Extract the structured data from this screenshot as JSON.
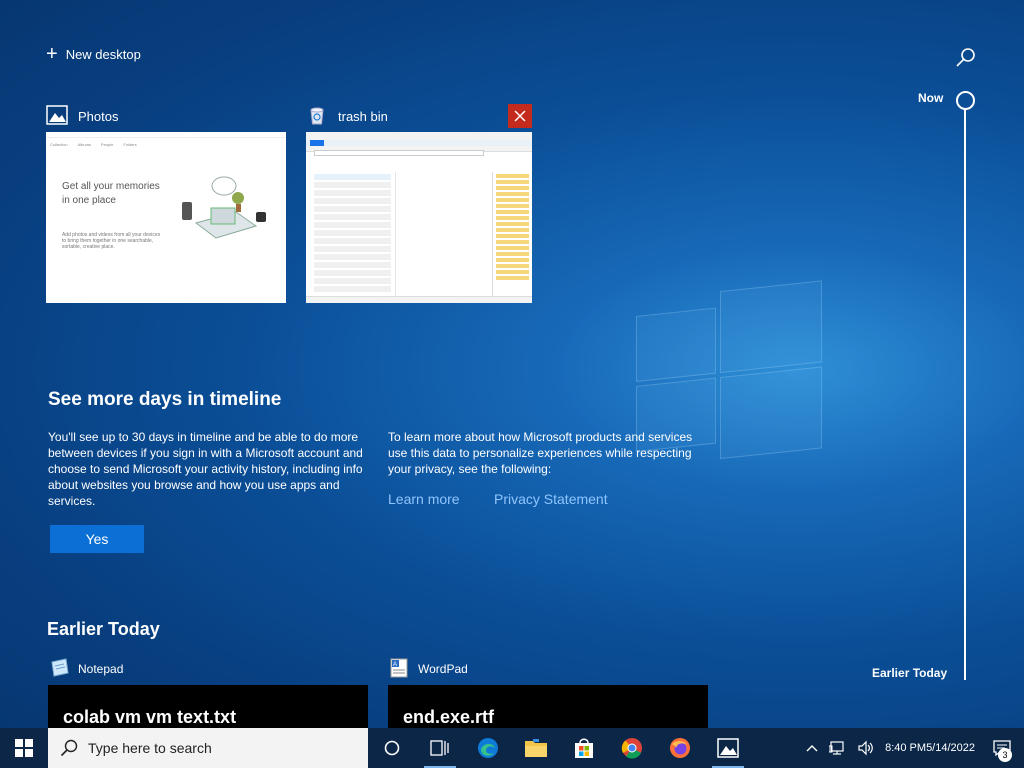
{
  "new_desktop": {
    "label": "New desktop"
  },
  "timeline": {
    "now_label": "Now",
    "earlier_label": "Earlier Today"
  },
  "windows": [
    {
      "app": "Photos",
      "thumb_text": "Get all your memories in one place",
      "thumb_small": "Add photos and videos from all your devices to bring them together in one searchable, sortable, creative place."
    },
    {
      "app": "trash bin"
    }
  ],
  "promo": {
    "title": "See more days in timeline",
    "left_text": "You'll see up to 30 days in timeline and be able to do more between devices if you sign in with a Microsoft account and choose to send Microsoft your activity history, including info about websites you browse and how you use apps and services.",
    "right_text": "To learn more about how Microsoft products and services use this data to personalize experiences while respecting your privacy, see the following:",
    "learn_more": "Learn more",
    "privacy": "Privacy Statement",
    "yes_button": "Yes"
  },
  "earlier": {
    "title": "Earlier Today",
    "activities": [
      {
        "app": "Notepad",
        "doc": "colab vm vm text.txt"
      },
      {
        "app": "WordPad",
        "doc": "end.exe.rtf"
      }
    ]
  },
  "taskbar": {
    "search_placeholder": "Type here to search",
    "time": "8:40 PM",
    "date": "5/14/2022",
    "notifications": "3"
  },
  "colors": {
    "accent": "#0b6fd6",
    "close": "#c42b1c",
    "taskbar": "#0b2647",
    "link": "#8fc5ff"
  }
}
